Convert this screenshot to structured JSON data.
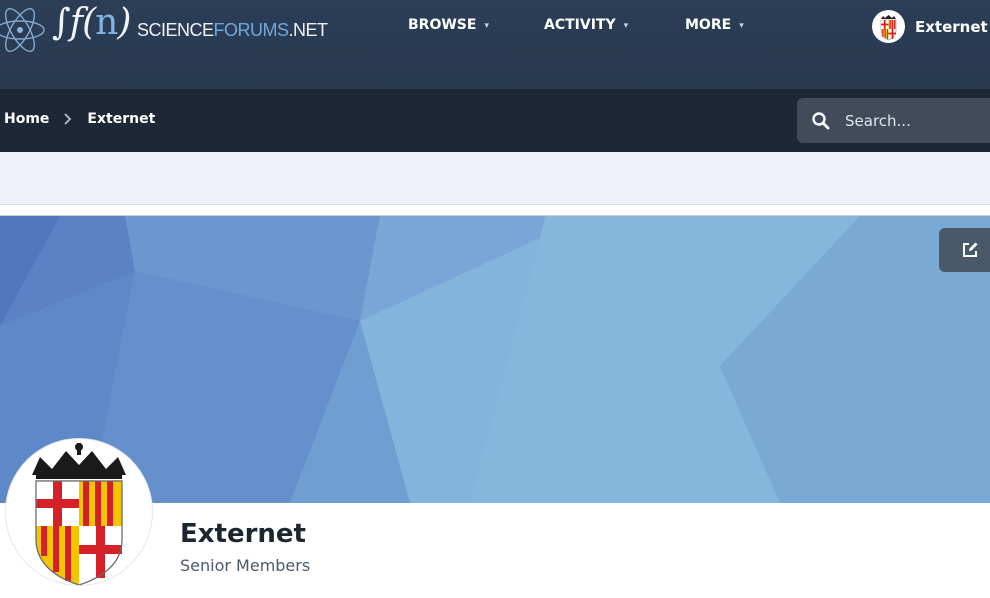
{
  "site": {
    "logo_fn": "f(n)",
    "logo_text_a": "SCIENCE",
    "logo_text_b": "FORUMS",
    "logo_text_c": ".NET"
  },
  "nav": {
    "items": [
      {
        "label": "BROWSE"
      },
      {
        "label": "ACTIVITY"
      },
      {
        "label": "MORE"
      }
    ]
  },
  "user": {
    "name": "Externet"
  },
  "breadcrumb": {
    "items": [
      "Home",
      "Externet"
    ]
  },
  "search": {
    "placeholder": "Search..."
  },
  "profile": {
    "name": "Externet",
    "group": "Senior Members"
  },
  "icons": [
    "atom-icon",
    "chevron-down-icon",
    "chevron-right-icon",
    "search-icon",
    "edit-icon"
  ],
  "colors": {
    "header_bg": "#2c3e57",
    "breadcrumb_bg": "#1d2736",
    "cover_blue": "#6f9fd4",
    "accent": "#6fa8dc"
  }
}
